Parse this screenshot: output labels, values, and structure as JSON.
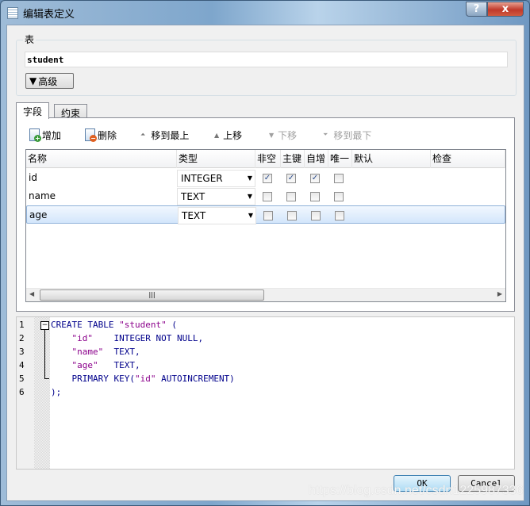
{
  "window": {
    "title": "编辑表定义",
    "help": "?",
    "close": "x"
  },
  "table_group": {
    "label": "表",
    "name_value": "student",
    "advanced_label": "高级"
  },
  "tabs": [
    {
      "label": "字段",
      "active": true
    },
    {
      "label": "约束",
      "active": false
    }
  ],
  "toolbar": {
    "add": "增加",
    "delete": "删除",
    "move_top": "移到最上",
    "move_up": "上移",
    "move_down": "下移",
    "move_bottom": "移到最下"
  },
  "columns": [
    "名称",
    "类型",
    "非空",
    "主键",
    "自增",
    "唯一",
    "默认",
    "检查"
  ],
  "rows": [
    {
      "name": "id",
      "type": "INTEGER",
      "not_null": true,
      "pk": true,
      "autoinc": true,
      "unique": false,
      "default": "",
      "check": ""
    },
    {
      "name": "name",
      "type": "TEXT",
      "not_null": false,
      "pk": false,
      "autoinc": false,
      "unique": false,
      "default": "",
      "check": ""
    },
    {
      "name": "age",
      "type": "TEXT",
      "not_null": false,
      "pk": false,
      "autoinc": false,
      "unique": false,
      "default": "",
      "check": "",
      "selected": true
    }
  ],
  "sql": {
    "line_numbers": [
      "1",
      "2",
      "3",
      "4",
      "5",
      "6"
    ],
    "lines": [
      "CREATE TABLE \"student\" (",
      "    \"id\"    INTEGER NOT NULL,",
      "    \"name\"  TEXT,",
      "    \"age\"   TEXT,",
      "    PRIMARY KEY(\"id\" AUTOINCREMENT)",
      ");"
    ]
  },
  "buttons": {
    "ok": "OK",
    "cancel": "Cancel"
  },
  "watermark": "https://blog.csdn.net/csdn1225987336"
}
